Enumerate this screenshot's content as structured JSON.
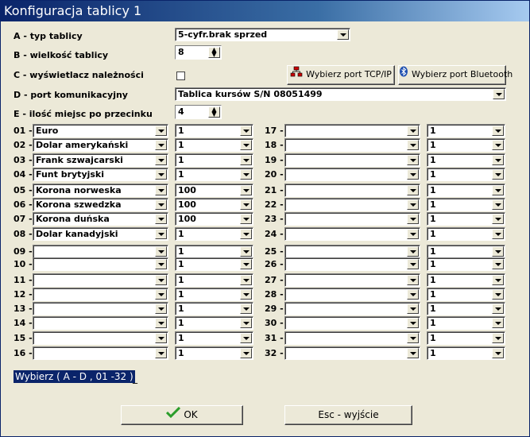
{
  "window": {
    "title": "Konfiguracja tablicy 1"
  },
  "fields": {
    "a": {
      "label": "A - typ tablicy",
      "value": "5-cyfr.brak sprzed"
    },
    "b": {
      "label": "B - wielkość tablicy",
      "value": "8"
    },
    "c": {
      "label": "C - wyświetlacz należności",
      "checked": false
    },
    "d": {
      "label": "D - port komunikacyjny",
      "value": "Tablica kursów S/N 08051499"
    },
    "e": {
      "label": "E - ilość miejsc po przecinku",
      "value": "4"
    }
  },
  "buttons": {
    "tcp": "Wybierz port TCP/IP",
    "bluetooth": "Wybierz port Bluetooth",
    "ok": "OK",
    "esc": "Esc - wyjście"
  },
  "rows": [
    {
      "num": "01 -",
      "currency": "Euro",
      "qty": "1"
    },
    {
      "num": "02 -",
      "currency": "Dolar amerykański",
      "qty": "1"
    },
    {
      "num": "03 -",
      "currency": "Frank szwajcarski",
      "qty": "1"
    },
    {
      "num": "04 -",
      "currency": "Funt brytyjski",
      "qty": "1"
    },
    {
      "num": "05 -",
      "currency": "Korona norweska",
      "qty": "100"
    },
    {
      "num": "06 -",
      "currency": "Korona szwedzka",
      "qty": "100"
    },
    {
      "num": "07 -",
      "currency": "Korona duńska",
      "qty": "100"
    },
    {
      "num": "08 -",
      "currency": "Dolar kanadyjski",
      "qty": "1"
    },
    {
      "num": "09 -",
      "currency": "",
      "qty": "1"
    },
    {
      "num": "10 -",
      "currency": "",
      "qty": "1"
    },
    {
      "num": "11 -",
      "currency": "",
      "qty": "1"
    },
    {
      "num": "12 -",
      "currency": "",
      "qty": "1"
    },
    {
      "num": "13 -",
      "currency": "",
      "qty": "1"
    },
    {
      "num": "14 -",
      "currency": "",
      "qty": "1"
    },
    {
      "num": "15 -",
      "currency": "",
      "qty": "1"
    },
    {
      "num": "16 -",
      "currency": "",
      "qty": "1"
    },
    {
      "num": "17 -",
      "currency": "",
      "qty": "1"
    },
    {
      "num": "18 -",
      "currency": "",
      "qty": "1"
    },
    {
      "num": "19 -",
      "currency": "",
      "qty": "1"
    },
    {
      "num": "20 -",
      "currency": "",
      "qty": "1"
    },
    {
      "num": "21 -",
      "currency": "",
      "qty": "1"
    },
    {
      "num": "22 -",
      "currency": "",
      "qty": "1"
    },
    {
      "num": "23 -",
      "currency": "",
      "qty": "1"
    },
    {
      "num": "24 -",
      "currency": "",
      "qty": "1"
    },
    {
      "num": "25 -",
      "currency": "",
      "qty": "1"
    },
    {
      "num": "26 -",
      "currency": "",
      "qty": "1"
    },
    {
      "num": "27 -",
      "currency": "",
      "qty": "1"
    },
    {
      "num": "28 -",
      "currency": "",
      "qty": "1"
    },
    {
      "num": "29 -",
      "currency": "",
      "qty": "1"
    },
    {
      "num": "30 -",
      "currency": "",
      "qty": "1"
    },
    {
      "num": "31 -",
      "currency": "",
      "qty": "1"
    },
    {
      "num": "32 -",
      "currency": "",
      "qty": "1"
    }
  ],
  "prompt": "Wybierz ( A - D , 01 -32 )",
  "cursor": "_",
  "colors": {
    "titlebar": "#0a246a",
    "face": "#ece9d8",
    "selection": "#0a246a"
  }
}
